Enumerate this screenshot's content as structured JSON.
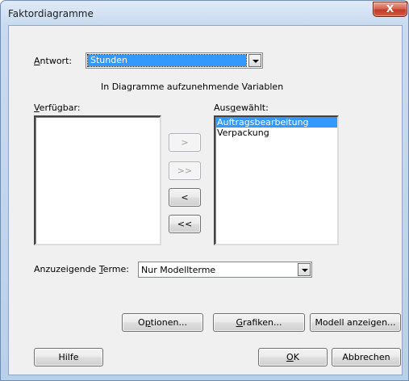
{
  "window": {
    "title": "Faktordiagramme",
    "close_glyph": "X"
  },
  "response": {
    "label": "Antwort:",
    "label_accel": "A",
    "label_rest": "ntwort:",
    "value": "Stunden"
  },
  "variables_heading": "In Diagramme aufzunehmende Variablen",
  "available": {
    "label_accel": "V",
    "label_rest": "erfügbar:",
    "items": []
  },
  "selected": {
    "label_pre": "Aus",
    "label_accel": "g",
    "label_post": "ewählt:",
    "items": [
      "Auftragsbearbeitung",
      "Verpackung"
    ],
    "selected_index": 0
  },
  "move_buttons": {
    "add": ">",
    "add_all": ">>",
    "remove": "<",
    "remove_all": "<<"
  },
  "terms": {
    "label_pre": "Anzuzeigende ",
    "label_accel": "T",
    "label_post": "erme:",
    "value": "Nur Modellterme"
  },
  "buttons": {
    "options_pre": "O",
    "options_accel": "p",
    "options_post": "tionen...",
    "graphs_accel": "G",
    "graphs_post": "rafiken...",
    "show_model": "Modell anzeigen...",
    "help": "Hilfe",
    "ok_accel": "O",
    "ok_post": "K",
    "cancel": "Abbrechen"
  },
  "colors": {
    "selection": "#3399ff",
    "close_button": "#c13c27",
    "dialog_background": "#f0f0f0"
  }
}
